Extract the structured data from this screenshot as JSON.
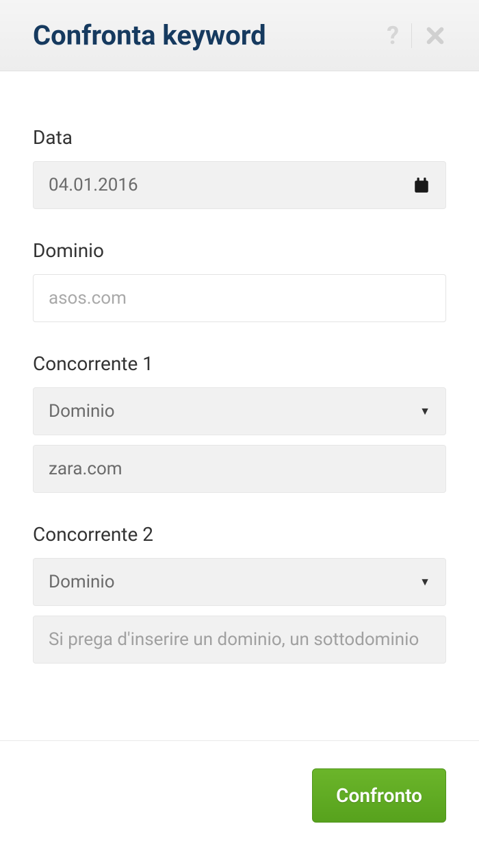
{
  "header": {
    "title": "Confronta keyword"
  },
  "fields": {
    "date": {
      "label": "Data",
      "value": "04.01.2016"
    },
    "domain": {
      "label": "Dominio",
      "placeholder": "asos.com",
      "value": ""
    },
    "competitor1": {
      "label": "Concorrente 1",
      "select_value": "Dominio",
      "input_value": "zara.com"
    },
    "competitor2": {
      "label": "Concorrente 2",
      "select_value": "Dominio",
      "input_placeholder": "Si prega d'inserire un dominio, un sottodominio"
    }
  },
  "footer": {
    "submit_label": "Confronto"
  }
}
